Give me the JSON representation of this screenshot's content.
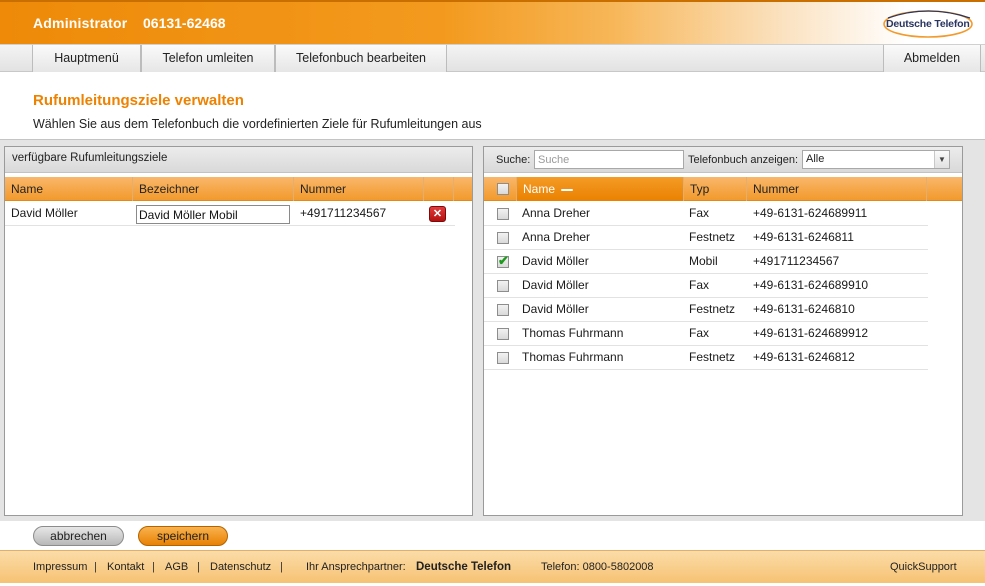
{
  "header": {
    "title": "Administrator",
    "phone": "06131-62468",
    "logo_text": "Deutsche Telefon",
    "colors": {
      "accent": "#ee8a08",
      "accent_text": "#ee8200"
    }
  },
  "nav": {
    "items": [
      {
        "label": "Hauptmenü"
      },
      {
        "label": "Telefon umleiten"
      },
      {
        "label": "Telefonbuch bearbeiten"
      }
    ],
    "logout": "Abmelden"
  },
  "page": {
    "title": "Rufumleitungsziele verwalten",
    "subtitle": "Wählen Sie aus dem Telefonbuch die vordefinierten Ziele für Rufumleitungen aus"
  },
  "left_panel": {
    "title": "verfügbare Rufumleitungsziele",
    "columns": [
      "Name",
      "Bezeichner",
      "Nummer"
    ],
    "rows": [
      {
        "name": "David Möller",
        "bezeichner": "David Möller Mobil",
        "nummer": "+491711234567",
        "delete_icon": "close-icon"
      }
    ]
  },
  "right_panel": {
    "search_label": "Suche:",
    "search_placeholder": "Suche",
    "phonebook_label": "Telefonbuch anzeigen:",
    "phonebook_selected": "Alle",
    "columns": [
      "Name",
      "Typ",
      "Nummer"
    ],
    "rows": [
      {
        "name": "Anna Dreher",
        "typ": "Fax",
        "nummer": "+49-6131-624689911",
        "checked": false
      },
      {
        "name": "Anna Dreher",
        "typ": "Festnetz",
        "nummer": "+49-6131-6246811",
        "checked": false
      },
      {
        "name": "David Möller",
        "typ": "Mobil",
        "nummer": "+491711234567",
        "checked": true
      },
      {
        "name": "David Möller",
        "typ": "Fax",
        "nummer": "+49-6131-624689910",
        "checked": false
      },
      {
        "name": "David Möller",
        "typ": "Festnetz",
        "nummer": "+49-6131-6246810",
        "checked": false
      },
      {
        "name": "Thomas Fuhrmann",
        "typ": "Fax",
        "nummer": "+49-6131-624689912",
        "checked": false
      },
      {
        "name": "Thomas Fuhrmann",
        "typ": "Festnetz",
        "nummer": "+49-6131-6246812",
        "checked": false
      }
    ]
  },
  "buttons": {
    "cancel": "abbrechen",
    "save": "speichern"
  },
  "footer": {
    "links": [
      "Impressum",
      "Kontakt",
      "AGB",
      "Datenschutz"
    ],
    "contact_label": "Ihr Ansprechpartner:",
    "contact_brand": "Deutsche Telefon",
    "phone": "Telefon: 0800-5802008",
    "support": "QuickSupport"
  }
}
